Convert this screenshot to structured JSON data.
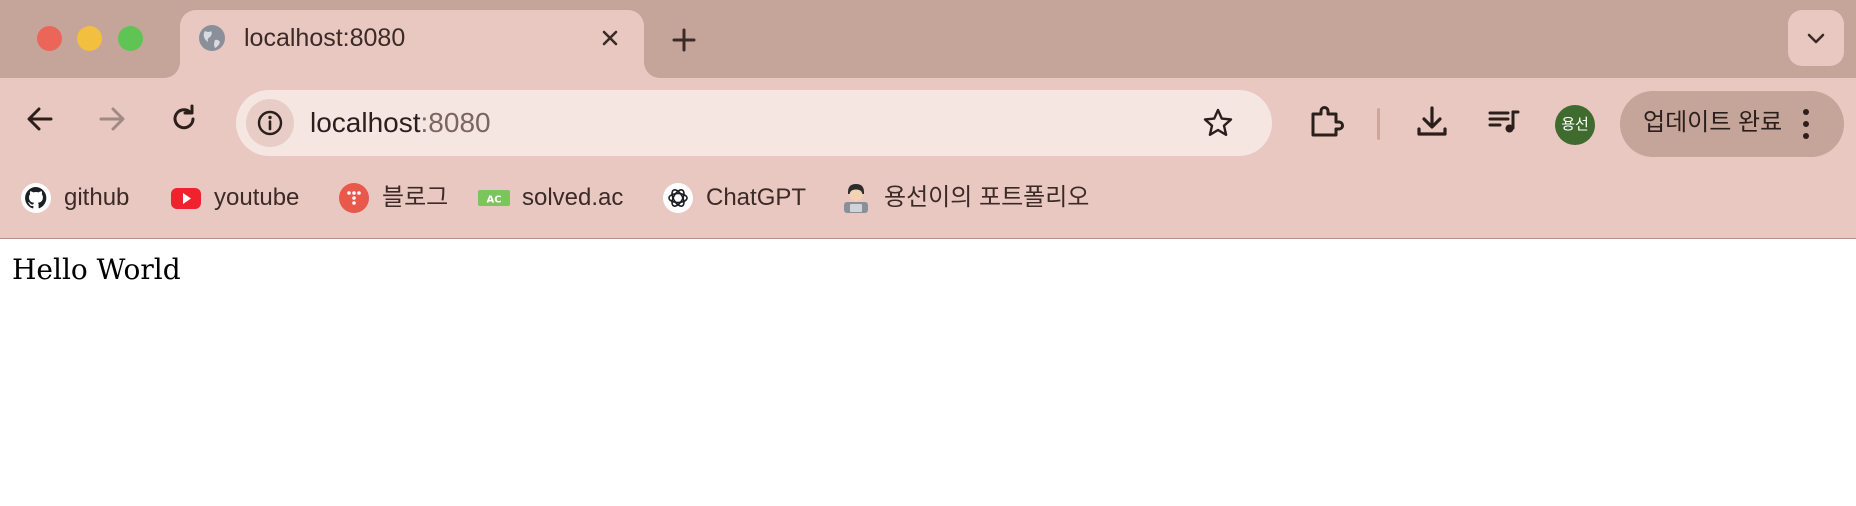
{
  "window": {
    "traffic_lights": [
      "close",
      "minimize",
      "maximize"
    ]
  },
  "tab": {
    "title": "localhost:8080",
    "favicon": "globe-icon"
  },
  "toolbar": {
    "back_icon": "arrow-left-icon",
    "forward_icon": "arrow-right-icon",
    "reload_icon": "reload-icon",
    "extensions_icon": "puzzle-icon",
    "downloads_icon": "download-icon",
    "media_icon": "media-queue-icon",
    "profile_initials": "용선",
    "update_label": "업데이트 완료",
    "menu_icon": "kebab-menu-icon"
  },
  "omnibox": {
    "host": "localhost",
    "port": ":8080",
    "site_info_icon": "info-icon",
    "bookmark_icon": "star-icon"
  },
  "bookmarks": [
    {
      "label": "github",
      "icon": "github-icon"
    },
    {
      "label": "youtube",
      "icon": "youtube-icon"
    },
    {
      "label": "블로그",
      "icon": "blog-icon"
    },
    {
      "label": "solved.ac",
      "icon": "solved-ac-icon"
    },
    {
      "label": "ChatGPT",
      "icon": "chatgpt-icon"
    },
    {
      "label": "용선이의 포트폴리오",
      "icon": "portfolio-avatar-icon"
    }
  ],
  "page": {
    "body_text": "Hello World"
  },
  "colors": {
    "tabstrip": "#c5a49a",
    "toolbar": "#e8c8c0",
    "omnibox": "#f5e6e2",
    "avatar": "#3f6b2e"
  }
}
